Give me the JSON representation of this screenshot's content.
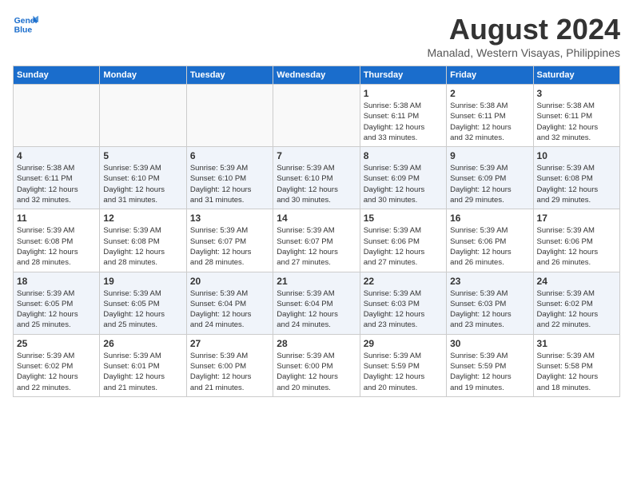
{
  "header": {
    "logo_line1": "General",
    "logo_line2": "Blue",
    "title": "August 2024",
    "subtitle": "Manalad, Western Visayas, Philippines"
  },
  "weekdays": [
    "Sunday",
    "Monday",
    "Tuesday",
    "Wednesday",
    "Thursday",
    "Friday",
    "Saturday"
  ],
  "weeks": [
    [
      {
        "day": "",
        "info": ""
      },
      {
        "day": "",
        "info": ""
      },
      {
        "day": "",
        "info": ""
      },
      {
        "day": "",
        "info": ""
      },
      {
        "day": "1",
        "info": "Sunrise: 5:38 AM\nSunset: 6:11 PM\nDaylight: 12 hours\nand 33 minutes."
      },
      {
        "day": "2",
        "info": "Sunrise: 5:38 AM\nSunset: 6:11 PM\nDaylight: 12 hours\nand 32 minutes."
      },
      {
        "day": "3",
        "info": "Sunrise: 5:38 AM\nSunset: 6:11 PM\nDaylight: 12 hours\nand 32 minutes."
      }
    ],
    [
      {
        "day": "4",
        "info": "Sunrise: 5:38 AM\nSunset: 6:11 PM\nDaylight: 12 hours\nand 32 minutes."
      },
      {
        "day": "5",
        "info": "Sunrise: 5:39 AM\nSunset: 6:10 PM\nDaylight: 12 hours\nand 31 minutes."
      },
      {
        "day": "6",
        "info": "Sunrise: 5:39 AM\nSunset: 6:10 PM\nDaylight: 12 hours\nand 31 minutes."
      },
      {
        "day": "7",
        "info": "Sunrise: 5:39 AM\nSunset: 6:10 PM\nDaylight: 12 hours\nand 30 minutes."
      },
      {
        "day": "8",
        "info": "Sunrise: 5:39 AM\nSunset: 6:09 PM\nDaylight: 12 hours\nand 30 minutes."
      },
      {
        "day": "9",
        "info": "Sunrise: 5:39 AM\nSunset: 6:09 PM\nDaylight: 12 hours\nand 29 minutes."
      },
      {
        "day": "10",
        "info": "Sunrise: 5:39 AM\nSunset: 6:08 PM\nDaylight: 12 hours\nand 29 minutes."
      }
    ],
    [
      {
        "day": "11",
        "info": "Sunrise: 5:39 AM\nSunset: 6:08 PM\nDaylight: 12 hours\nand 28 minutes."
      },
      {
        "day": "12",
        "info": "Sunrise: 5:39 AM\nSunset: 6:08 PM\nDaylight: 12 hours\nand 28 minutes."
      },
      {
        "day": "13",
        "info": "Sunrise: 5:39 AM\nSunset: 6:07 PM\nDaylight: 12 hours\nand 28 minutes."
      },
      {
        "day": "14",
        "info": "Sunrise: 5:39 AM\nSunset: 6:07 PM\nDaylight: 12 hours\nand 27 minutes."
      },
      {
        "day": "15",
        "info": "Sunrise: 5:39 AM\nSunset: 6:06 PM\nDaylight: 12 hours\nand 27 minutes."
      },
      {
        "day": "16",
        "info": "Sunrise: 5:39 AM\nSunset: 6:06 PM\nDaylight: 12 hours\nand 26 minutes."
      },
      {
        "day": "17",
        "info": "Sunrise: 5:39 AM\nSunset: 6:06 PM\nDaylight: 12 hours\nand 26 minutes."
      }
    ],
    [
      {
        "day": "18",
        "info": "Sunrise: 5:39 AM\nSunset: 6:05 PM\nDaylight: 12 hours\nand 25 minutes."
      },
      {
        "day": "19",
        "info": "Sunrise: 5:39 AM\nSunset: 6:05 PM\nDaylight: 12 hours\nand 25 minutes."
      },
      {
        "day": "20",
        "info": "Sunrise: 5:39 AM\nSunset: 6:04 PM\nDaylight: 12 hours\nand 24 minutes."
      },
      {
        "day": "21",
        "info": "Sunrise: 5:39 AM\nSunset: 6:04 PM\nDaylight: 12 hours\nand 24 minutes."
      },
      {
        "day": "22",
        "info": "Sunrise: 5:39 AM\nSunset: 6:03 PM\nDaylight: 12 hours\nand 23 minutes."
      },
      {
        "day": "23",
        "info": "Sunrise: 5:39 AM\nSunset: 6:03 PM\nDaylight: 12 hours\nand 23 minutes."
      },
      {
        "day": "24",
        "info": "Sunrise: 5:39 AM\nSunset: 6:02 PM\nDaylight: 12 hours\nand 22 minutes."
      }
    ],
    [
      {
        "day": "25",
        "info": "Sunrise: 5:39 AM\nSunset: 6:02 PM\nDaylight: 12 hours\nand 22 minutes."
      },
      {
        "day": "26",
        "info": "Sunrise: 5:39 AM\nSunset: 6:01 PM\nDaylight: 12 hours\nand 21 minutes."
      },
      {
        "day": "27",
        "info": "Sunrise: 5:39 AM\nSunset: 6:00 PM\nDaylight: 12 hours\nand 21 minutes."
      },
      {
        "day": "28",
        "info": "Sunrise: 5:39 AM\nSunset: 6:00 PM\nDaylight: 12 hours\nand 20 minutes."
      },
      {
        "day": "29",
        "info": "Sunrise: 5:39 AM\nSunset: 5:59 PM\nDaylight: 12 hours\nand 20 minutes."
      },
      {
        "day": "30",
        "info": "Sunrise: 5:39 AM\nSunset: 5:59 PM\nDaylight: 12 hours\nand 19 minutes."
      },
      {
        "day": "31",
        "info": "Sunrise: 5:39 AM\nSunset: 5:58 PM\nDaylight: 12 hours\nand 18 minutes."
      }
    ]
  ]
}
